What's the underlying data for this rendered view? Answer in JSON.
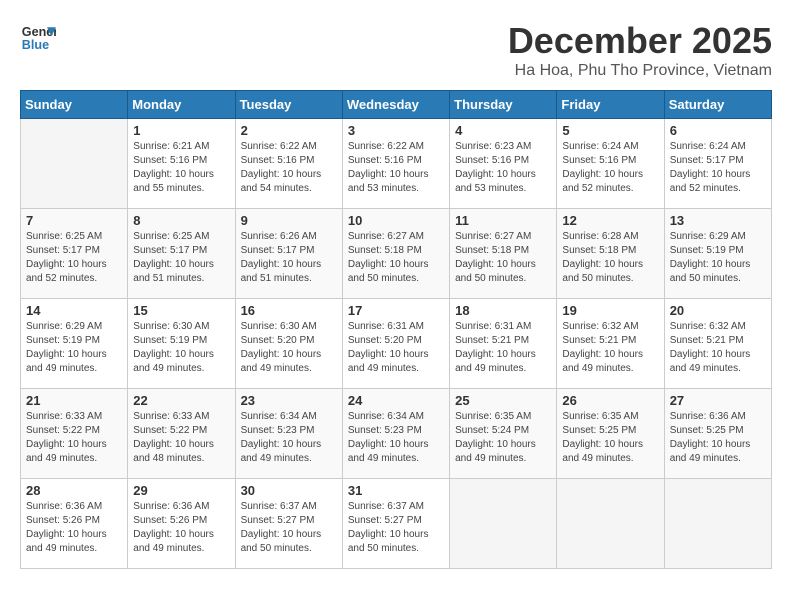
{
  "header": {
    "logo_line1": "General",
    "logo_line2": "Blue",
    "month": "December 2025",
    "location": "Ha Hoa, Phu Tho Province, Vietnam"
  },
  "weekdays": [
    "Sunday",
    "Monday",
    "Tuesday",
    "Wednesday",
    "Thursday",
    "Friday",
    "Saturday"
  ],
  "weeks": [
    [
      {
        "day": "",
        "sunrise": "",
        "sunset": "",
        "daylight": ""
      },
      {
        "day": "1",
        "sunrise": "Sunrise: 6:21 AM",
        "sunset": "Sunset: 5:16 PM",
        "daylight": "Daylight: 10 hours and 55 minutes."
      },
      {
        "day": "2",
        "sunrise": "Sunrise: 6:22 AM",
        "sunset": "Sunset: 5:16 PM",
        "daylight": "Daylight: 10 hours and 54 minutes."
      },
      {
        "day": "3",
        "sunrise": "Sunrise: 6:22 AM",
        "sunset": "Sunset: 5:16 PM",
        "daylight": "Daylight: 10 hours and 53 minutes."
      },
      {
        "day": "4",
        "sunrise": "Sunrise: 6:23 AM",
        "sunset": "Sunset: 5:16 PM",
        "daylight": "Daylight: 10 hours and 53 minutes."
      },
      {
        "day": "5",
        "sunrise": "Sunrise: 6:24 AM",
        "sunset": "Sunset: 5:16 PM",
        "daylight": "Daylight: 10 hours and 52 minutes."
      },
      {
        "day": "6",
        "sunrise": "Sunrise: 6:24 AM",
        "sunset": "Sunset: 5:17 PM",
        "daylight": "Daylight: 10 hours and 52 minutes."
      }
    ],
    [
      {
        "day": "7",
        "sunrise": "Sunrise: 6:25 AM",
        "sunset": "Sunset: 5:17 PM",
        "daylight": "Daylight: 10 hours and 52 minutes."
      },
      {
        "day": "8",
        "sunrise": "Sunrise: 6:25 AM",
        "sunset": "Sunset: 5:17 PM",
        "daylight": "Daylight: 10 hours and 51 minutes."
      },
      {
        "day": "9",
        "sunrise": "Sunrise: 6:26 AM",
        "sunset": "Sunset: 5:17 PM",
        "daylight": "Daylight: 10 hours and 51 minutes."
      },
      {
        "day": "10",
        "sunrise": "Sunrise: 6:27 AM",
        "sunset": "Sunset: 5:18 PM",
        "daylight": "Daylight: 10 hours and 50 minutes."
      },
      {
        "day": "11",
        "sunrise": "Sunrise: 6:27 AM",
        "sunset": "Sunset: 5:18 PM",
        "daylight": "Daylight: 10 hours and 50 minutes."
      },
      {
        "day": "12",
        "sunrise": "Sunrise: 6:28 AM",
        "sunset": "Sunset: 5:18 PM",
        "daylight": "Daylight: 10 hours and 50 minutes."
      },
      {
        "day": "13",
        "sunrise": "Sunrise: 6:29 AM",
        "sunset": "Sunset: 5:19 PM",
        "daylight": "Daylight: 10 hours and 50 minutes."
      }
    ],
    [
      {
        "day": "14",
        "sunrise": "Sunrise: 6:29 AM",
        "sunset": "Sunset: 5:19 PM",
        "daylight": "Daylight: 10 hours and 49 minutes."
      },
      {
        "day": "15",
        "sunrise": "Sunrise: 6:30 AM",
        "sunset": "Sunset: 5:19 PM",
        "daylight": "Daylight: 10 hours and 49 minutes."
      },
      {
        "day": "16",
        "sunrise": "Sunrise: 6:30 AM",
        "sunset": "Sunset: 5:20 PM",
        "daylight": "Daylight: 10 hours and 49 minutes."
      },
      {
        "day": "17",
        "sunrise": "Sunrise: 6:31 AM",
        "sunset": "Sunset: 5:20 PM",
        "daylight": "Daylight: 10 hours and 49 minutes."
      },
      {
        "day": "18",
        "sunrise": "Sunrise: 6:31 AM",
        "sunset": "Sunset: 5:21 PM",
        "daylight": "Daylight: 10 hours and 49 minutes."
      },
      {
        "day": "19",
        "sunrise": "Sunrise: 6:32 AM",
        "sunset": "Sunset: 5:21 PM",
        "daylight": "Daylight: 10 hours and 49 minutes."
      },
      {
        "day": "20",
        "sunrise": "Sunrise: 6:32 AM",
        "sunset": "Sunset: 5:21 PM",
        "daylight": "Daylight: 10 hours and 49 minutes."
      }
    ],
    [
      {
        "day": "21",
        "sunrise": "Sunrise: 6:33 AM",
        "sunset": "Sunset: 5:22 PM",
        "daylight": "Daylight: 10 hours and 49 minutes."
      },
      {
        "day": "22",
        "sunrise": "Sunrise: 6:33 AM",
        "sunset": "Sunset: 5:22 PM",
        "daylight": "Daylight: 10 hours and 48 minutes."
      },
      {
        "day": "23",
        "sunrise": "Sunrise: 6:34 AM",
        "sunset": "Sunset: 5:23 PM",
        "daylight": "Daylight: 10 hours and 49 minutes."
      },
      {
        "day": "24",
        "sunrise": "Sunrise: 6:34 AM",
        "sunset": "Sunset: 5:23 PM",
        "daylight": "Daylight: 10 hours and 49 minutes."
      },
      {
        "day": "25",
        "sunrise": "Sunrise: 6:35 AM",
        "sunset": "Sunset: 5:24 PM",
        "daylight": "Daylight: 10 hours and 49 minutes."
      },
      {
        "day": "26",
        "sunrise": "Sunrise: 6:35 AM",
        "sunset": "Sunset: 5:25 PM",
        "daylight": "Daylight: 10 hours and 49 minutes."
      },
      {
        "day": "27",
        "sunrise": "Sunrise: 6:36 AM",
        "sunset": "Sunset: 5:25 PM",
        "daylight": "Daylight: 10 hours and 49 minutes."
      }
    ],
    [
      {
        "day": "28",
        "sunrise": "Sunrise: 6:36 AM",
        "sunset": "Sunset: 5:26 PM",
        "daylight": "Daylight: 10 hours and 49 minutes."
      },
      {
        "day": "29",
        "sunrise": "Sunrise: 6:36 AM",
        "sunset": "Sunset: 5:26 PM",
        "daylight": "Daylight: 10 hours and 49 minutes."
      },
      {
        "day": "30",
        "sunrise": "Sunrise: 6:37 AM",
        "sunset": "Sunset: 5:27 PM",
        "daylight": "Daylight: 10 hours and 50 minutes."
      },
      {
        "day": "31",
        "sunrise": "Sunrise: 6:37 AM",
        "sunset": "Sunset: 5:27 PM",
        "daylight": "Daylight: 10 hours and 50 minutes."
      },
      {
        "day": "",
        "sunrise": "",
        "sunset": "",
        "daylight": ""
      },
      {
        "day": "",
        "sunrise": "",
        "sunset": "",
        "daylight": ""
      },
      {
        "day": "",
        "sunrise": "",
        "sunset": "",
        "daylight": ""
      }
    ]
  ]
}
